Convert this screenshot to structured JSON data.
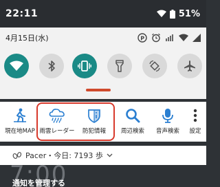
{
  "status_bar": {
    "time": "22:11",
    "battery": "51%"
  },
  "panel": {
    "date": "4月15日(水)",
    "status_icons": [
      "p-icon",
      "alarm-icon",
      "signal-alt-icon",
      "wifi-small-icon",
      "cell-signal-icon"
    ],
    "toggles": [
      {
        "name": "wifi",
        "state": "on"
      },
      {
        "name": "bluetooth",
        "state": "off"
      },
      {
        "name": "vibrate",
        "state": "on"
      },
      {
        "name": "flashlight",
        "state": "off"
      },
      {
        "name": "auto-rotate",
        "state": "off"
      },
      {
        "name": "airplane-mode",
        "state": "off"
      }
    ]
  },
  "shortcuts": [
    {
      "label": "現在地MAP",
      "icon": "walker-icon"
    },
    {
      "label": "雨雲レーダー",
      "icon": "rain-cloud-icon"
    },
    {
      "label": "防犯情報",
      "icon": "shield-info-icon"
    },
    {
      "label": "周辺検索",
      "icon": "search-icon"
    },
    {
      "label": "音声検索",
      "icon": "microphone-icon"
    },
    {
      "label": "設定",
      "icon": "more-vert-icon"
    }
  ],
  "pacer": {
    "text": "Pacer・今日: 7193 歩"
  },
  "lockscreen": {
    "clock_partial": "7:00",
    "manage": "通知を管理する"
  },
  "colors": {
    "accent_teal": "#1a8a86",
    "highlight_red": "#d8392b",
    "shortcut_blue": "#2b7fd1"
  }
}
